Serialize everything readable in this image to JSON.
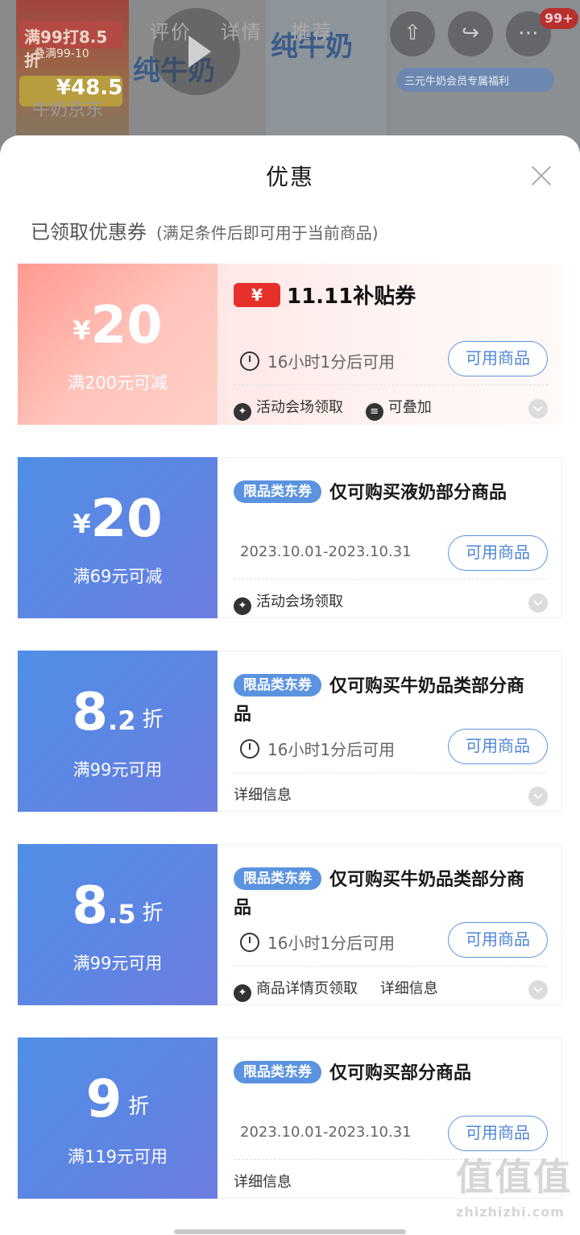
{
  "background": {
    "promo_line1": "满99打8.5折",
    "promo_line2": "叠满99-10",
    "promo_price": "¥48.5",
    "product_text": "纯牛奶",
    "tabs": [
      "评价",
      "详情",
      "推荐"
    ],
    "sub_tabs": "牛奶京东",
    "member_banner": "三元牛奶会员专属福利",
    "cart_badge": "99+"
  },
  "sheet": {
    "title": "优惠",
    "section_title": "已领取优惠券",
    "section_note": "(满足条件后即可用于当前商品)"
  },
  "coupons": [
    {
      "style": "red",
      "amount_currency": "¥",
      "amount_number": "20",
      "amount_decimal": "",
      "amount_unit": "",
      "condition": "满200元可减",
      "logo_currency": "¥",
      "logo_label": "11.11补贴券",
      "tag": "",
      "title": "",
      "validity": "16小时1分后可用",
      "button": "可用商品",
      "meta": [
        "活动会场领取",
        "可叠加"
      ]
    },
    {
      "style": "blue",
      "amount_currency": "¥",
      "amount_number": "20",
      "amount_decimal": "",
      "amount_unit": "",
      "condition": "满69元可减",
      "tag": "限品类东券",
      "title": "仅可购买液奶部分商品",
      "validity": "2023.10.01-2023.10.31",
      "button": "可用商品",
      "meta": [
        "活动会场领取"
      ]
    },
    {
      "style": "blue",
      "amount_currency": "",
      "amount_number": "8",
      "amount_decimal": ".2",
      "amount_unit": "折",
      "condition": "满99元可用",
      "tag": "限品类东券",
      "title": "仅可购买牛奶品类部分商品",
      "validity": "16小时1分后可用",
      "button": "可用商品",
      "meta": [
        "详细信息"
      ]
    },
    {
      "style": "blue",
      "amount_currency": "",
      "amount_number": "8",
      "amount_decimal": ".5",
      "amount_unit": "折",
      "condition": "满99元可用",
      "tag": "限品类东券",
      "title": "仅可购买牛奶品类部分商品",
      "validity": "16小时1分后可用",
      "button": "可用商品",
      "meta": [
        "商品详情页领取",
        "详细信息"
      ]
    },
    {
      "style": "blue",
      "amount_currency": "",
      "amount_number": "9",
      "amount_decimal": "",
      "amount_unit": "折",
      "condition": "满119元可用",
      "tag": "限品类东券",
      "title": "仅可购买部分商品",
      "validity": "2023.10.01-2023.10.31",
      "button": "可用商品",
      "meta": [
        "详细信息"
      ]
    }
  ],
  "watermark": {
    "text": "值值值",
    "url": "zhizhizhi.com"
  }
}
